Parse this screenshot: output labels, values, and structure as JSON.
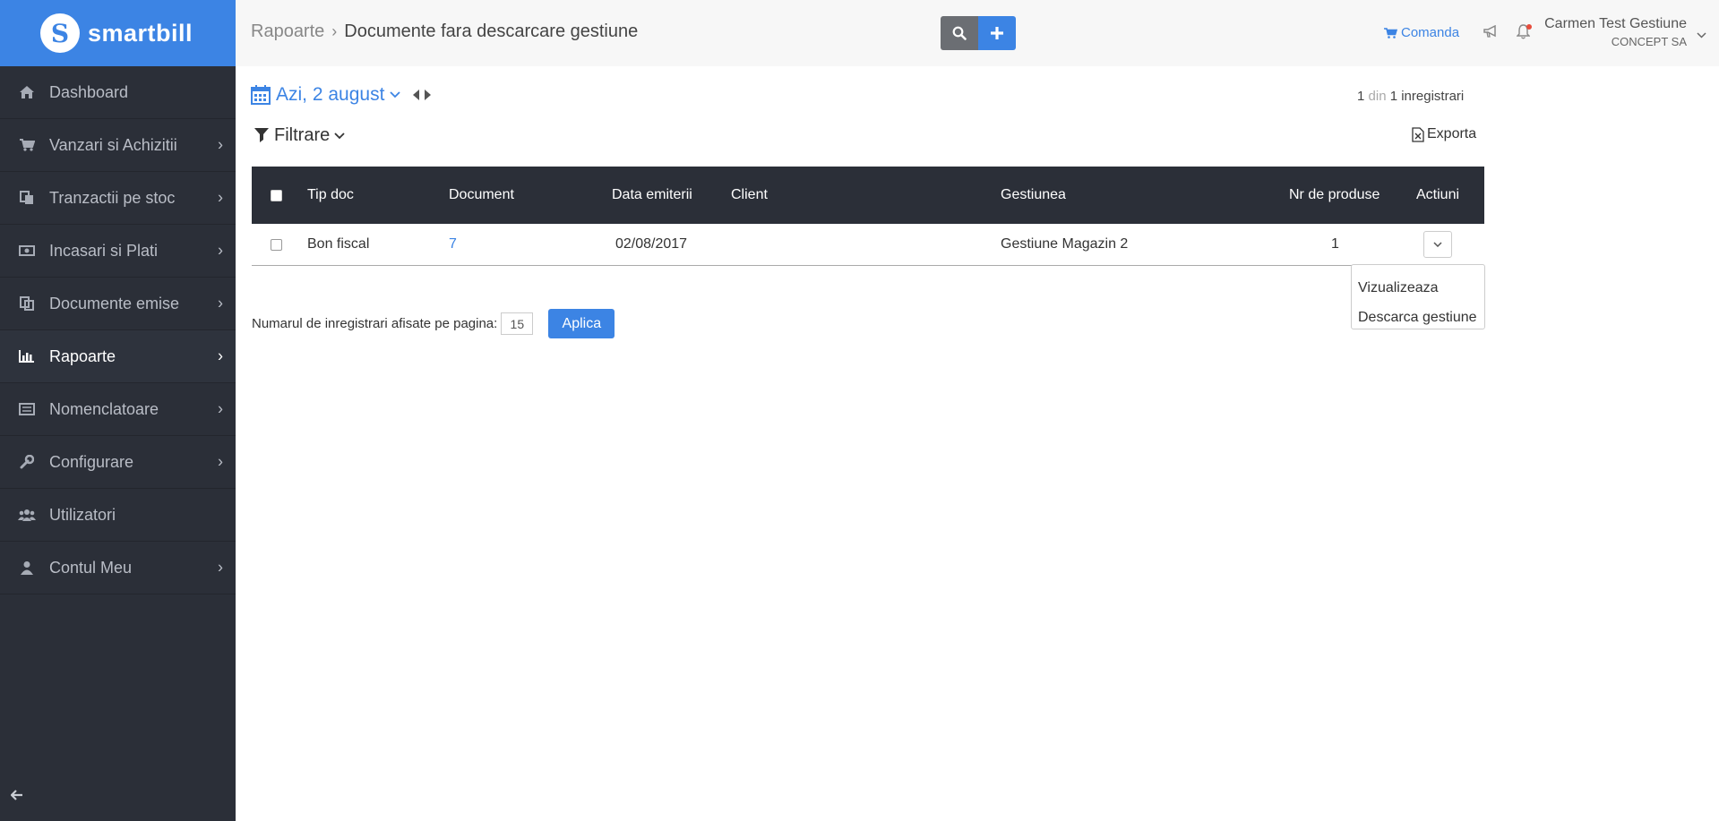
{
  "brand": {
    "name": "smartbill",
    "logo_letter": "S"
  },
  "sidebar": {
    "items": [
      {
        "label": "Dashboard",
        "icon": "home-icon",
        "has_submenu": false
      },
      {
        "label": "Vanzari si Achizitii",
        "icon": "cart-icon",
        "has_submenu": true
      },
      {
        "label": "Tranzactii pe stoc",
        "icon": "copy-icon",
        "has_submenu": true
      },
      {
        "label": "Incasari si Plati",
        "icon": "money-icon",
        "has_submenu": true
      },
      {
        "label": "Documente emise",
        "icon": "documents-icon",
        "has_submenu": true
      },
      {
        "label": "Rapoarte",
        "icon": "bar-chart-icon",
        "has_submenu": true,
        "active": true
      },
      {
        "label": "Nomenclatoare",
        "icon": "list-icon",
        "has_submenu": true
      },
      {
        "label": "Configurare",
        "icon": "wrench-icon",
        "has_submenu": true
      },
      {
        "label": "Utilizatori",
        "icon": "users-icon",
        "has_submenu": false
      },
      {
        "label": "Contul Meu",
        "icon": "user-icon",
        "has_submenu": true
      }
    ]
  },
  "header": {
    "breadcrumb_parent": "Rapoarte",
    "breadcrumb_current": "Documente fara descarcare gestiune",
    "comanda_label": "Comanda",
    "user_name": "Carmen Test Gestiune",
    "user_company": "CONCEPT SA"
  },
  "toolbar": {
    "date_label": "Azi, 2 august",
    "count_current": "1",
    "count_din": "din",
    "count_total": "1 inregistrari",
    "filter_label": "Filtrare",
    "export_label": "Exporta"
  },
  "table": {
    "columns": [
      "Tip doc",
      "Document",
      "Data emiterii",
      "Client",
      "Gestiunea",
      "Nr de produse",
      "Actiuni"
    ],
    "rows": [
      {
        "tip_doc": "Bon fiscal",
        "document": "7",
        "data": "02/08/2017",
        "client": "",
        "gestiunea": "Gestiune Magazin 2",
        "nr_produse": "1"
      }
    ]
  },
  "actions_menu": {
    "items": [
      "Vizualizeaza",
      "Descarca gestiune"
    ]
  },
  "pagination": {
    "label": "Numarul de inregistrari afisate pe pagina:",
    "value": "15",
    "apply_label": "Aplica"
  },
  "colors": {
    "accent": "#3c84e4",
    "sidebar_bg": "#2b2f38",
    "table_header_bg": "#2b2f38"
  }
}
